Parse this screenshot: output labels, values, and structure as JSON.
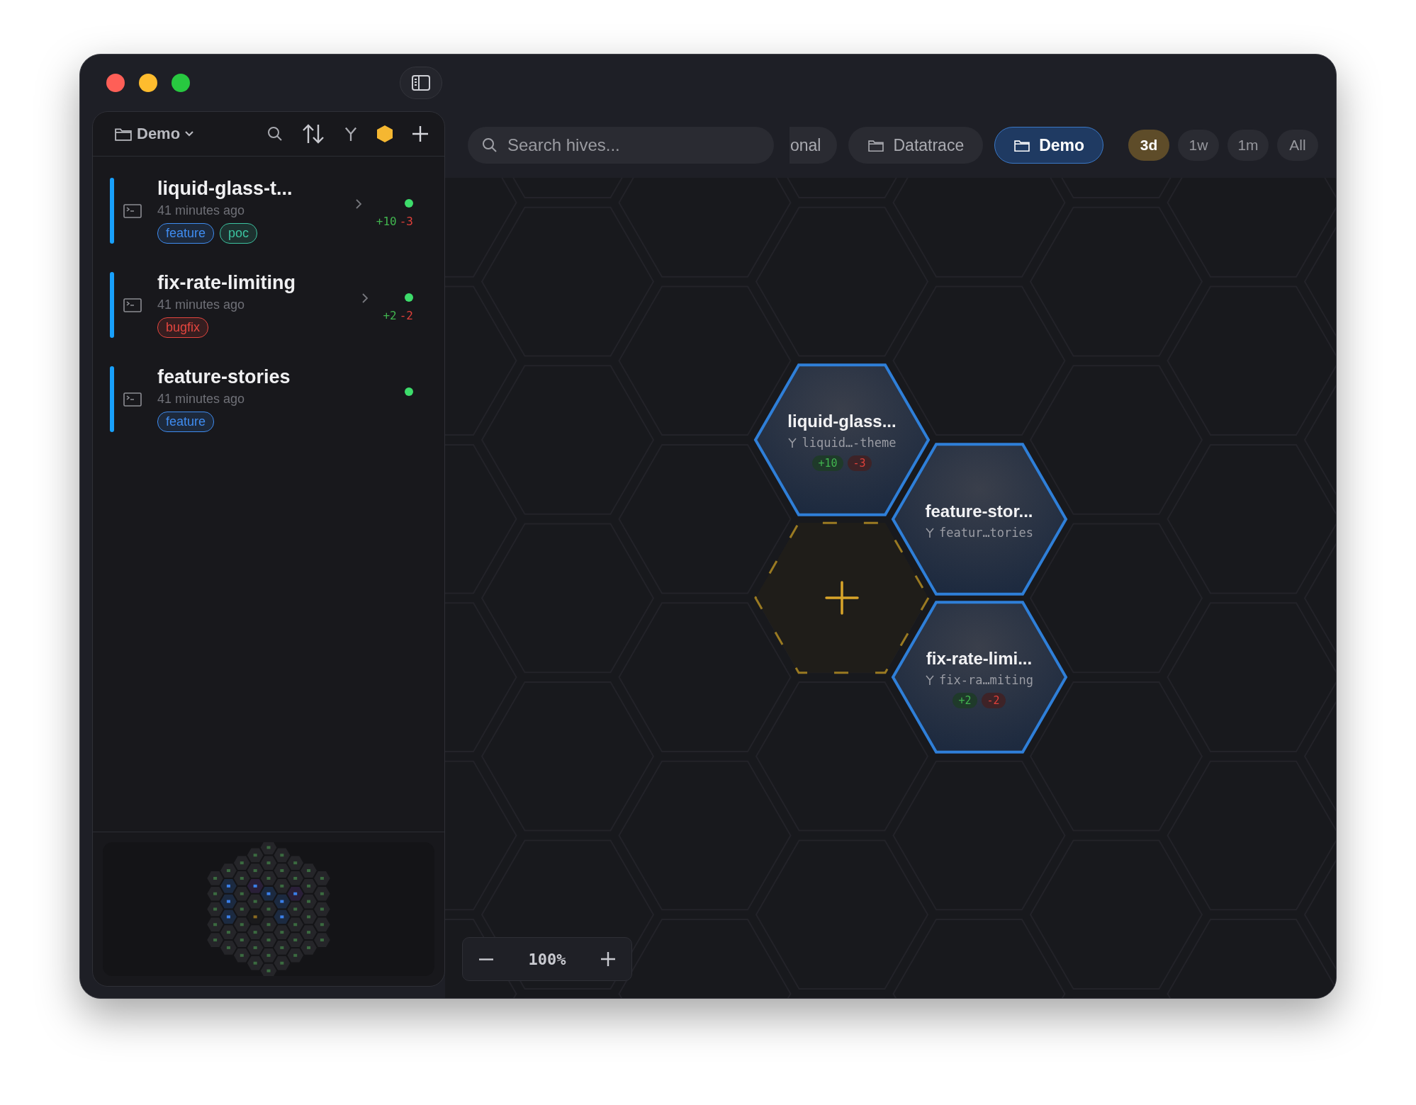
{
  "sidebar": {
    "project": "Demo",
    "sessions": [
      {
        "name": "liquid-glass-t...",
        "time": "41 minutes ago",
        "tags": [
          {
            "label": "feature",
            "color": "#3f8cf0"
          },
          {
            "label": "poc",
            "color": "#3cc3a0"
          }
        ],
        "online": true,
        "added": "+10",
        "removed": "-3"
      },
      {
        "name": "fix-rate-limiting",
        "time": "41 minutes ago",
        "tags": [
          {
            "label": "bugfix",
            "color": "#e5463f"
          }
        ],
        "online": true,
        "added": "+2",
        "removed": "-2"
      },
      {
        "name": "feature-stories",
        "time": "41 minutes ago",
        "tags": [
          {
            "label": "feature",
            "color": "#3f8cf0"
          }
        ],
        "online": true
      }
    ]
  },
  "search": {
    "placeholder": "Search hives..."
  },
  "projects": [
    {
      "label": "onal",
      "selected": false,
      "kind": "cut"
    },
    {
      "label": "Datatrace",
      "selected": false,
      "kind": "folder"
    },
    {
      "label": "Demo",
      "selected": true,
      "kind": "folder"
    }
  ],
  "ranges": [
    {
      "label": "3d",
      "selected": true
    },
    {
      "label": "1w",
      "selected": false
    },
    {
      "label": "1m",
      "selected": false
    },
    {
      "label": "All",
      "selected": false
    }
  ],
  "hives": [
    {
      "kind": "hive",
      "title": "liquid-glass...",
      "branch": "liquid…-theme",
      "added": "+10",
      "removed": "-3"
    },
    {
      "kind": "add"
    },
    {
      "kind": "hive",
      "title": "feature-stor...",
      "branch": "featur…tories"
    },
    {
      "kind": "hive",
      "title": "fix-rate-limi...",
      "branch": "fix-ra…miting",
      "added": "+2",
      "removed": "-2"
    }
  ],
  "zoom": {
    "value": "100%"
  }
}
